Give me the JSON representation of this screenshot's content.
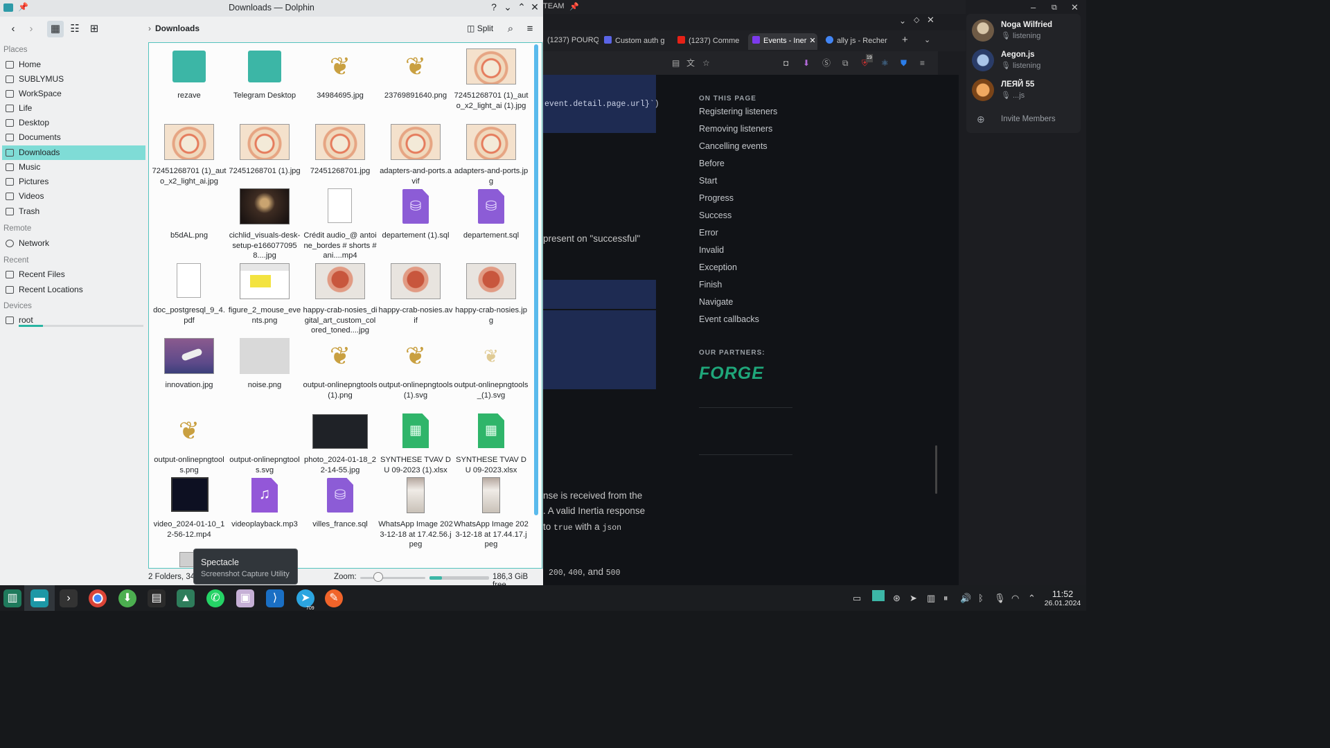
{
  "dolphin": {
    "title": "Downloads — Dolphin",
    "breadcrumb": "Downloads",
    "split_label": "Split",
    "places": {
      "places_header": "Places",
      "places": [
        "Home",
        "SUBLYMUS",
        "WorkSpace",
        "Life",
        "Desktop",
        "Documents",
        "Downloads",
        "Music",
        "Pictures",
        "Videos",
        "Trash"
      ],
      "remote_header": "Remote",
      "remote": [
        "Network"
      ],
      "recent_header": "Recent",
      "recent": [
        "Recent Files",
        "Recent Locations"
      ],
      "devices_header": "Devices",
      "devices": [
        "root"
      ]
    },
    "files": [
      {
        "name": "rezave",
        "kind": "folder"
      },
      {
        "name": "Telegram Desktop",
        "kind": "folder"
      },
      {
        "name": "34984695.jpg",
        "kind": "bird"
      },
      {
        "name": "23769891640.png",
        "kind": "bird"
      },
      {
        "name": "72451268701 (1)_auto_x2_light_ai (1).jpg",
        "kind": "diagram"
      },
      {
        "name": "72451268701 (1)_auto_x2_light_ai.jpg",
        "kind": "diagram"
      },
      {
        "name": "72451268701 (1).jpg",
        "kind": "diagram"
      },
      {
        "name": "72451268701.jpg",
        "kind": "diagram"
      },
      {
        "name": "adapters-and-ports.avif",
        "kind": "diagram"
      },
      {
        "name": "adapters-and-ports.jpg",
        "kind": "diagram"
      },
      {
        "name": "b5dAL.png",
        "kind": "blank"
      },
      {
        "name": "cichlid_visuals-desk-setup-e1660770958....jpg",
        "kind": "desk"
      },
      {
        "name": "Crédit audio_@ antoine_bordes # shorts #ani....mp4",
        "kind": "doc"
      },
      {
        "name": "departement (1).sql",
        "kind": "sql"
      },
      {
        "name": "departement.sql",
        "kind": "sql"
      },
      {
        "name": "doc_postgresql_9_4.pdf",
        "kind": "doc"
      },
      {
        "name": "figure_2_mouse_events.png",
        "kind": "figure"
      },
      {
        "name": "happy-crab-nosies_digital_art_custom_colored_toned....jpg",
        "kind": "crab"
      },
      {
        "name": "happy-crab-nosies.avif",
        "kind": "crab"
      },
      {
        "name": "happy-crab-nosies.jpg",
        "kind": "crab"
      },
      {
        "name": "innovation.jpg",
        "kind": "rocket"
      },
      {
        "name": "noise.png",
        "kind": "noise"
      },
      {
        "name": "output-onlinepngtools (1).png",
        "kind": "bird"
      },
      {
        "name": "output-onlinepngtools (1).svg",
        "kind": "bird"
      },
      {
        "name": "output-onlinepngtools_(1).svg",
        "kind": "bird-light"
      },
      {
        "name": "output-onlinepngtools.png",
        "kind": "bird"
      },
      {
        "name": "output-onlinepngtools.svg",
        "kind": "blank"
      },
      {
        "name": "photo_2024-01-18_22-14-55.jpg",
        "kind": "code"
      },
      {
        "name": "SYNTHESE TVAV DU 09-2023 (1).xlsx",
        "kind": "xls"
      },
      {
        "name": "SYNTHESE TVAV DU 09-2023.xlsx",
        "kind": "xls"
      },
      {
        "name": "video_2024-01-10_12-56-12.mp4",
        "kind": "video"
      },
      {
        "name": "videoplayback.mp3",
        "kind": "mp3"
      },
      {
        "name": "villes_france.sql",
        "kind": "sql"
      },
      {
        "name": "WhatsApp Image 2023-12-18 at 17.42.56.jpeg",
        "kind": "wa"
      },
      {
        "name": "WhatsApp Image 2023-12-18 at 17.44.17.jpeg",
        "kind": "wa"
      }
    ],
    "status": {
      "summary": "2 Folders, 34",
      "zoom_label": "Zoom:",
      "free_space": "186,3 GiB free",
      "disk_used_fraction": 0.21
    },
    "tooltip": {
      "title": "Spectacle",
      "subtitle": "Screenshot Capture Utility"
    }
  },
  "browser": {
    "window_title_fragment": "TEAM",
    "tabs": [
      "(1237) POURQ",
      "Custom auth g",
      "(1237) Comme",
      "Events - Iner",
      "ally js - Recher"
    ],
    "active_tab_index": 3,
    "code_fragment": "event.detail.page.url}`)",
    "text_fragments": {
      "successful": "present on \"successful\"",
      "response_1": "nse is received from the",
      "response_2": ". A valid Inertia response",
      "response_3_pre": "to",
      "response_3_code1": "true",
      "response_3_mid": "with a",
      "response_3_code2": "json",
      "status_codes_pre": "",
      "code_200": "200",
      "code_400": "400",
      "and": "and",
      "code_500": "500"
    },
    "on_this_page_header": "ON THIS PAGE",
    "on_this_page": [
      "Registering listeners",
      "Removing listeners",
      "Cancelling events",
      "Before",
      "Start",
      "Progress",
      "Success",
      "Error",
      "Invalid",
      "Exception",
      "Finish",
      "Navigate",
      "Event callbacks"
    ],
    "partners_header": "OUR PARTNERS:",
    "partner_name": "FORGE",
    "ext_badge": "19"
  },
  "discord": {
    "members": [
      {
        "name": "Noga Wilfried",
        "status": "listening"
      },
      {
        "name": "Aegon.js",
        "status": "listening"
      },
      {
        "name": "ЛЕЯЙ 55",
        "status": "...js"
      }
    ],
    "invite_label": "Invite Members"
  },
  "taskbar": {
    "telegram_badge": "709",
    "clock_time": "11:52",
    "clock_date": "26.01.2024"
  },
  "colors": {
    "accent_teal": "#7fdcd6",
    "selection_border": "#53c2bd",
    "forge_green": "#1fa67a",
    "doc_code_bg": "#1e2b52"
  }
}
